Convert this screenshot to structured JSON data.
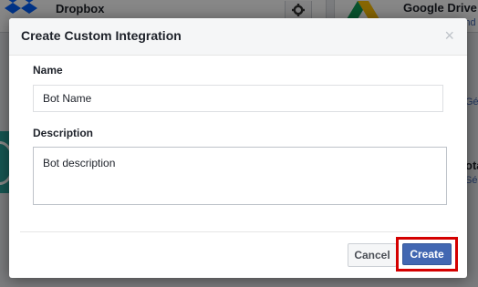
{
  "background": {
    "cards": [
      {
        "title": "Dropbox"
      },
      {
        "title": "Google Drive",
        "subtitle": "And"
      }
    ],
    "side_texts": [
      "Gén",
      "ota",
      "Sér"
    ]
  },
  "modal": {
    "title": "Create Custom Integration",
    "close_glyph": "×",
    "name_label": "Name",
    "name_value": "Bot Name",
    "description_label": "Description",
    "description_value": "Bot description",
    "cancel_label": "Cancel",
    "create_label": "Create"
  },
  "colors": {
    "primary_button": "#4267b2",
    "highlight_border": "#d40000"
  }
}
